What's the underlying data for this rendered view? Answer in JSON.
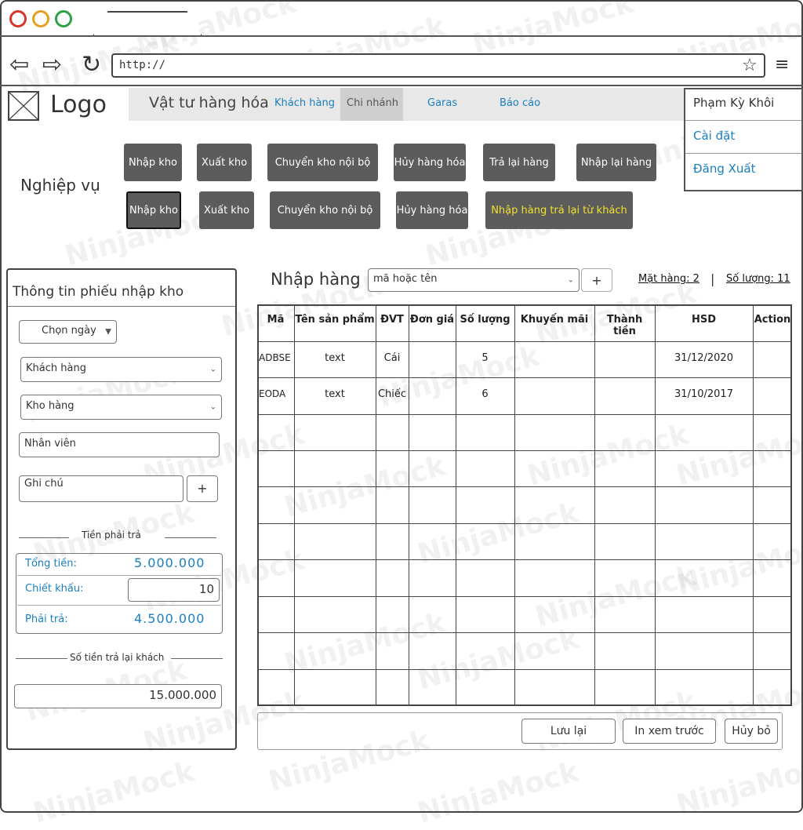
{
  "browser": {
    "url": "http://",
    "window_dots": [
      "#d9342b",
      "#e5a020",
      "#2ea043"
    ]
  },
  "header": {
    "logo": "Logo",
    "menu": {
      "vat_tu": "Vật tư hàng hóa",
      "khach_hang": "Khách hàng",
      "chi_nhanh": "Chi nhánh",
      "garas": "Garas",
      "bao_cao": "Báo cáo"
    },
    "user": {
      "name": "Phạm Kỳ Khôi",
      "settings": "Cài đặt",
      "logout": "Đăng Xuất"
    }
  },
  "nghiep_vu": {
    "label": "Nghiệp vụ",
    "row1": [
      "Nhập kho",
      "Xuất kho",
      "Chuyển kho nội bộ",
      "Hủy hàng hóa",
      "Trả lại hàng",
      "Nhập lại hàng"
    ],
    "row2": [
      "Nhập kho",
      "Xuất kho",
      "Chuyển kho nội bộ",
      "Hủy hàng hóa",
      "Nhập hàng trả lại từ khách"
    ]
  },
  "left": {
    "title": "Thông tin phiếu nhập kho",
    "date_button": "Chọn ngày",
    "customer_placeholder": "Khách hàng",
    "warehouse_placeholder": "Kho hàng",
    "staff_placeholder": "Nhân viên",
    "note_placeholder": "Ghi chú",
    "plus": "+",
    "pay_section": "Tiền phải trả",
    "total_label": "Tổng tiền:",
    "total_value": "5.000.000",
    "discount_label": "Chiết khấu:",
    "discount_value": "10",
    "pay_label": "Phải trả:",
    "pay_value": "4.500.000",
    "refund_section": "Số tiền trả lại khách",
    "refund_value": "15.000.000"
  },
  "right": {
    "title": "Nhập hàng",
    "search_placeholder": "mã hoặc tên",
    "plus": "+",
    "items_label": "Mặt hàng: 2",
    "separator": "|",
    "qty_label": "Số lượng: 11",
    "columns": [
      "Mã",
      "Tên sản phẩm",
      "ĐVT",
      "Đơn giá",
      "Số lượng",
      "Khuyến mãi",
      "Thành tiền",
      "HSD",
      "Action"
    ],
    "rows": [
      [
        "ADBSE",
        "text",
        "Cái",
        "",
        "5",
        "",
        "",
        "31/12/2020",
        ""
      ],
      [
        "EODA",
        "text",
        "Chiếc",
        "",
        "6",
        "",
        "",
        "31/10/2017",
        ""
      ]
    ],
    "buttons": {
      "save": "Lưu lại",
      "print": "In xem trước",
      "cancel": "Hủy bỏ"
    }
  },
  "colors": {
    "accent": "#1a7fbf",
    "button_dark": "#5c5c5c",
    "highlight": "#f2e12c"
  },
  "watermark": "NinjaMock"
}
